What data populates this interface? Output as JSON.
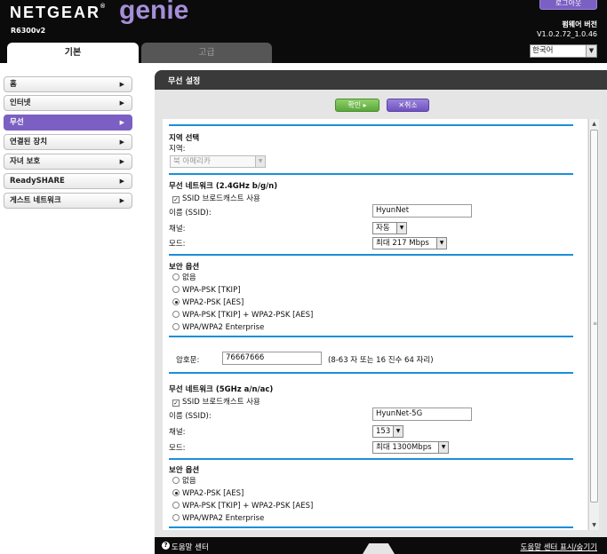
{
  "header": {
    "brand": "NETGEAR",
    "product": "genie",
    "model": "R6300v2",
    "logout_label": "로그아웃",
    "firmware_label": "펌웨어 버전",
    "firmware_version": "V1.0.2.72_1.0.46",
    "language": "한국어",
    "tabs": {
      "basic": "기본",
      "advanced": "고급"
    }
  },
  "sidebar": {
    "items": [
      {
        "label": "홈"
      },
      {
        "label": "인터넷"
      },
      {
        "label": "무선"
      },
      {
        "label": "연결된 장치"
      },
      {
        "label": "자녀 보호"
      },
      {
        "label": "ReadySHARE"
      },
      {
        "label": "게스트 네트워크"
      }
    ]
  },
  "panel": {
    "title": "무선 설정",
    "apply_label": "확인 ▸",
    "cancel_label": "✕취소"
  },
  "region": {
    "title": "지역 선택",
    "region_label": "지역:",
    "region_value": "북 아메리카"
  },
  "wifi24": {
    "title": "무선 네트워크 (2.4GHz b/g/n)",
    "ssid_broadcast": "SSID 브로드캐스트 사용",
    "ssid_label": "이름 (SSID):",
    "ssid_value": "HyunNet",
    "channel_label": "채널:",
    "channel_value": "자동",
    "mode_label": "모드:",
    "mode_value": "최대 217 Mbps"
  },
  "security24": {
    "title": "보안 옵션",
    "options": [
      {
        "label": "없음",
        "selected": false
      },
      {
        "label": "WPA-PSK [TKIP]",
        "selected": false
      },
      {
        "label": "WPA2-PSK [AES]",
        "selected": true
      },
      {
        "label": "WPA-PSK [TKIP] + WPA2-PSK [AES]",
        "selected": false
      },
      {
        "label": "WPA/WPA2 Enterprise",
        "selected": false
      }
    ],
    "password_label": "암호문:",
    "password_value": "76667666",
    "password_hint": "(8-63 자 또는 16 진수 64 자리)"
  },
  "wifi5": {
    "title": "무선 네트워크 (5GHz a/n/ac)",
    "ssid_broadcast": "SSID 브로드캐스트 사용",
    "ssid_label": "이름 (SSID):",
    "ssid_value": "HyunNet-5G",
    "channel_label": "채널:",
    "channel_value": "153",
    "mode_label": "모드:",
    "mode_value": "최대 1300Mbps"
  },
  "security5": {
    "title": "보안 옵션",
    "options": [
      {
        "label": "없음",
        "selected": false
      },
      {
        "label": "WPA2-PSK [AES]",
        "selected": true
      },
      {
        "label": "WPA-PSK [TKIP] + WPA2-PSK [AES]",
        "selected": false
      },
      {
        "label": "WPA/WPA2 Enterprise",
        "selected": false
      }
    ]
  },
  "footer": {
    "help_center": "도움말 센터",
    "help_toggle": "도움말 센터 표시/숨기기"
  }
}
